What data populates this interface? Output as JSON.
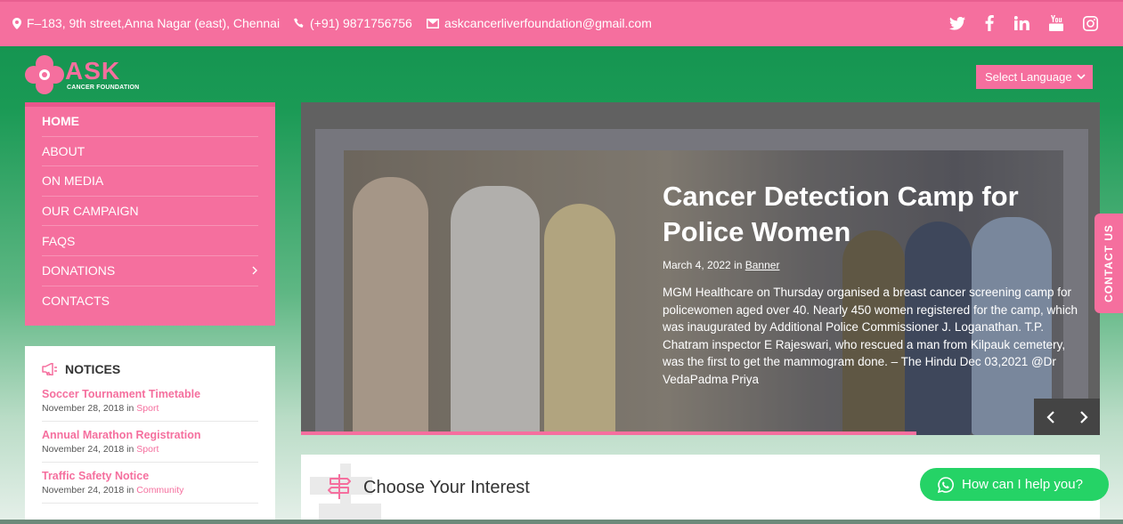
{
  "topbar": {
    "address": "F–183, 9th street,Anna Nagar (east), Chennai",
    "phone": "(+91) 9871756756",
    "email": "askcancerliverfoundation@gmail.com",
    "social": [
      "twitter-icon",
      "facebook-icon",
      "linkedin-icon",
      "youtube-icon",
      "instagram-icon"
    ]
  },
  "logo": {
    "name": "ASK",
    "tagline": "CANCER FOUNDATION"
  },
  "language": {
    "label": "Select Language"
  },
  "nav": {
    "items": [
      {
        "label": "HOME"
      },
      {
        "label": "ABOUT"
      },
      {
        "label": "ON MEDIA"
      },
      {
        "label": "OUR CAMPAIGN"
      },
      {
        "label": "FAQS"
      },
      {
        "label": "DONATIONS"
      },
      {
        "label": "CONTACTS"
      }
    ]
  },
  "notices": {
    "title": "NOTICES",
    "items": [
      {
        "title": "Soccer Tournament Timetable",
        "date": "November 28, 2018",
        "in": "in",
        "category": "Sport"
      },
      {
        "title": "Annual Marathon Registration",
        "date": "November 24, 2018",
        "in": "in",
        "category": "Sport"
      },
      {
        "title": "Traffic Safety Notice",
        "date": "November 24, 2018",
        "in": "in",
        "category": "Community"
      }
    ]
  },
  "banner": {
    "title": "Cancer Detection Camp for Police Women",
    "date": "March 4, 2022",
    "in": "in",
    "category": "Banner",
    "body": "MGM Healthcare on Thursday organised a breast cancer screening camp for policewomen aged over 40. Nearly 450 women registered for the camp, which was inaugurated by Additional Police Commissioner J. Loganathan. T.P. Chatram inspector E Rajeswari, who rescued a man from Kilpauk cemetery, was the first to get the mammogram done. – The Hindu Dec 03,2021 @Dr VedaPadma Priya",
    "progress_percent": 77
  },
  "choose": {
    "title": "Choose Your Interest"
  },
  "contact_tab": {
    "label": "CONTACT US"
  },
  "whatsapp": {
    "label": "How can I help you?"
  },
  "colors": {
    "accent": "#f56f9e",
    "green": "#12914e",
    "whatsapp": "#25d366"
  }
}
